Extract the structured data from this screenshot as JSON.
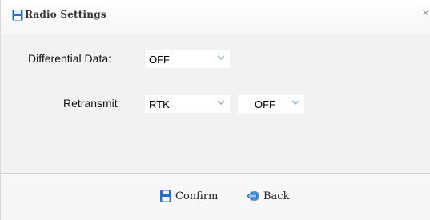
{
  "dialog": {
    "title": "Radio Settings",
    "close_glyph": "×",
    "title_icon": "floppy-disk-icon"
  },
  "fields": {
    "differential_data": {
      "label": "Differential Data:",
      "value": "OFF"
    },
    "retransmit": {
      "label": "Retransmit:",
      "mode_value": "RTK",
      "state_value": "OFF"
    }
  },
  "buttons": {
    "confirm": {
      "label": "Confirm",
      "icon": "floppy-disk-icon"
    },
    "back": {
      "label": "Back",
      "icon": "back-arrow-icon"
    }
  },
  "colors": {
    "icon_blue": "#2a6fc9",
    "chevron_blue": "#8ab4e0"
  }
}
